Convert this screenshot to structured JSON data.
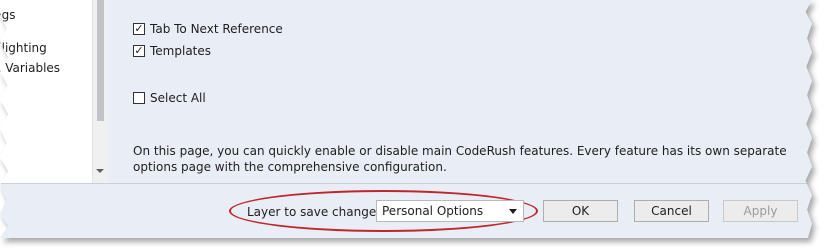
{
  "tree": {
    "items": [
      "dlighting",
      "e Variables"
    ]
  },
  "options": {
    "checkboxes": [
      {
        "label": "Tab To Next Reference",
        "checked": true
      },
      {
        "label": "Templates",
        "checked": true
      },
      {
        "label": "Select All",
        "checked": false
      }
    ],
    "description": "On this page, you can quickly enable or disable main CodeRush features. Every feature has its own separate options page with the comprehensive configuration."
  },
  "footer": {
    "layer_label": "Layer to save changes:",
    "layer_value": "Personal Options",
    "ok_label": "OK",
    "cancel_label": "Cancel",
    "apply_label": "Apply"
  },
  "colors": {
    "highlight_oval": "#c0272d",
    "panel_background": "#e9edf5"
  }
}
